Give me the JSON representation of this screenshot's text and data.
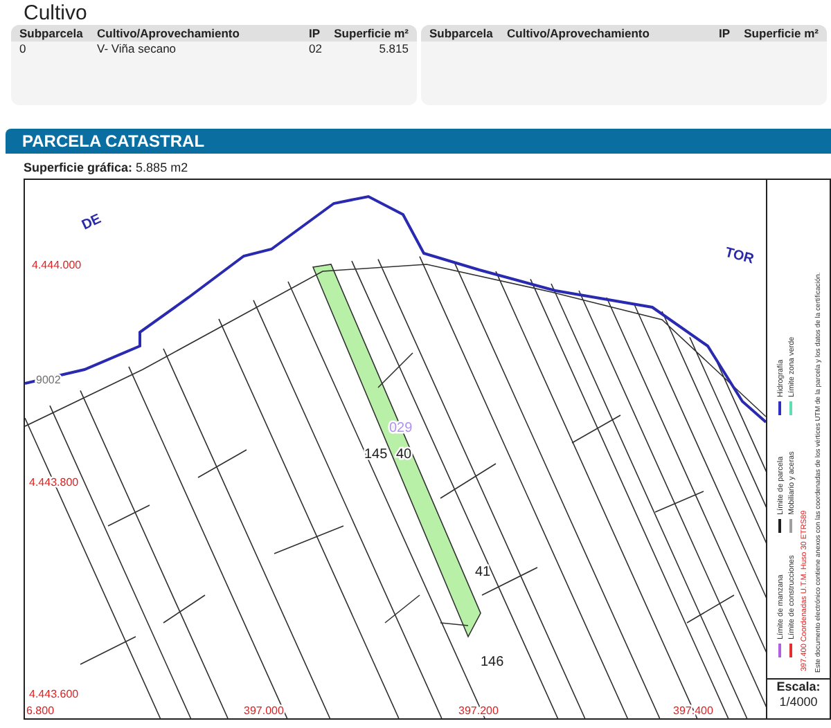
{
  "cultivo": {
    "title": "Cultivo",
    "tables": [
      {
        "columns": [
          "Subparcela",
          "Cultivo/Aprovechamiento",
          "IP",
          "Superficie m²"
        ],
        "rows": [
          [
            "0",
            "V- Viña secano",
            "02",
            "5.815"
          ]
        ]
      },
      {
        "columns": [
          "Subparcela",
          "Cultivo/Aprovechamiento",
          "IP",
          "Superficie m²"
        ]
      }
    ]
  },
  "parcela": {
    "title": "PARCELA CATASTRAL",
    "surface_label": "Superficie gráfica:",
    "surface_value": "5.885 m2",
    "map_labels": [
      {
        "text": "DE",
        "kind": "place"
      },
      {
        "text": "TOR",
        "kind": "place"
      },
      {
        "text": "4.444.000",
        "kind": "coord"
      },
      {
        "text": "4.443.800",
        "kind": "coord"
      },
      {
        "text": "4.443.600",
        "kind": "coord"
      },
      {
        "text": "6.800",
        "kind": "coord"
      },
      {
        "text": "397.000",
        "kind": "coord"
      },
      {
        "text": "397.200",
        "kind": "coord"
      },
      {
        "text": "397.400",
        "kind": "coord"
      },
      {
        "text": "9002",
        "kind": "road"
      },
      {
        "text": "029",
        "kind": "subparcel"
      },
      {
        "text": "145",
        "kind": "parcel"
      },
      {
        "text": "40",
        "kind": "parcel"
      },
      {
        "text": "41",
        "kind": "parcel"
      },
      {
        "text": "146",
        "kind": "parcel"
      }
    ],
    "legend": [
      {
        "label": "Límite de manzana",
        "color": "#b060e0"
      },
      {
        "label": "Límite de construcciones",
        "color": "#e03030"
      },
      {
        "label": "Límite de parcela",
        "color": "#202020"
      },
      {
        "label": "Mobiliario y aceras",
        "color": "#a0a0a0"
      },
      {
        "label": "Hidrografía",
        "color": "#3030c0"
      },
      {
        "label": "Límite zona verde",
        "color": "#60e0b0"
      }
    ],
    "coord_note": "397.400 Coordenadas U.T.M. Huso 30 ETRS89",
    "document_note": "Este documento electrónico contiene anexos con las coordenadas de los vértices UTM de la parcela y los datos de la certificación.",
    "scale_label": "Escala:",
    "scale_value": "1/4000"
  }
}
